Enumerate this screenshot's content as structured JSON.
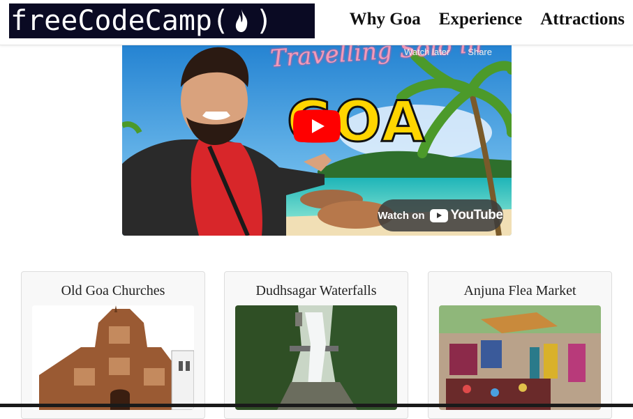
{
  "brand": {
    "logo_text_left": "freeCodeCamp(",
    "logo_text_right": ")"
  },
  "nav": {
    "items": [
      "Why Goa",
      "Experience",
      "Attractions"
    ]
  },
  "video": {
    "title_overlay": "Travelling Solo in",
    "big_text": "GOA",
    "watch_later": "Watch later",
    "share": "Share",
    "watch_on": "Watch on",
    "youtube": "YouTube"
  },
  "cards": [
    {
      "title": "Old Goa Churches"
    },
    {
      "title": "Dudhsagar Waterfalls"
    },
    {
      "title": "Anjuna Flea Market"
    }
  ],
  "colors": {
    "logo_bg": "#0a0a23",
    "youtube_red": "#ff0000",
    "goa_yellow": "#ffd500"
  }
}
